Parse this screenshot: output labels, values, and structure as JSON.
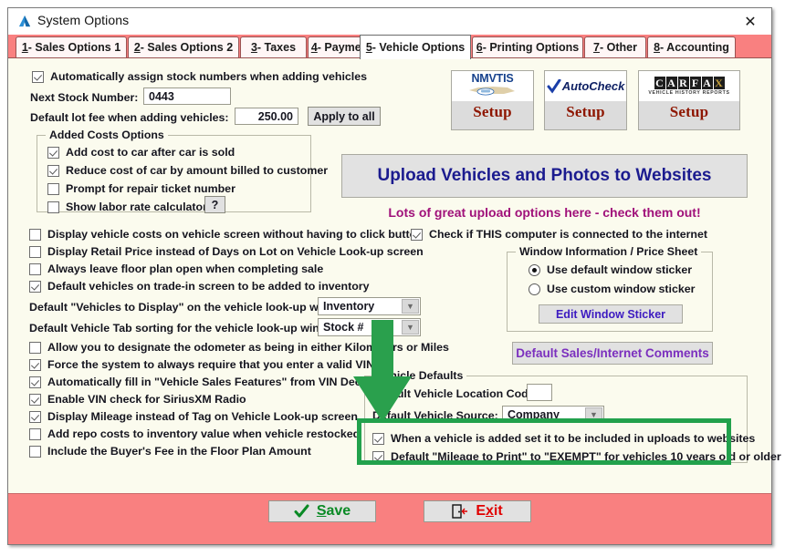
{
  "window": {
    "title": "System Options",
    "close_icon": "close-icon",
    "app_icon": "app-logo-icon"
  },
  "tabs": [
    {
      "num": "1",
      "label": " - Sales Options 1",
      "active": false
    },
    {
      "num": "2",
      "label": " - Sales Options 2",
      "active": false
    },
    {
      "num": "3",
      "label": " - Taxes",
      "active": false
    },
    {
      "num": "4",
      "label": " - Payment Options",
      "active": false
    },
    {
      "num": "5",
      "label": " - Vehicle Options",
      "active": true
    },
    {
      "num": "6",
      "label": " - Printing Options",
      "active": false
    },
    {
      "num": "7",
      "label": " - Other",
      "active": false
    },
    {
      "num": "8",
      "label": " - Accounting",
      "active": false
    }
  ],
  "left": {
    "auto_stock_label": "Automatically assign stock numbers when adding vehicles",
    "auto_stock_checked": true,
    "next_stock_label": "Next Stock Number:",
    "next_stock_value": "0443",
    "lot_fee_label": "Default lot fee when adding vehicles:",
    "lot_fee_value": "250.00",
    "apply_all_label": "Apply to all",
    "added_costs": {
      "title": "Added Costs Options",
      "items": [
        {
          "label": "Add cost to car after car is sold",
          "checked": true
        },
        {
          "label": "Reduce cost of car by amount billed to customer",
          "checked": true
        },
        {
          "label": "Prompt for repair ticket number",
          "checked": false
        },
        {
          "label": "Show labor rate calculator",
          "checked": false
        }
      ],
      "help_label": "?"
    },
    "checks_mid": [
      {
        "label": "Display vehicle costs on vehicle screen without having to click button",
        "checked": false
      },
      {
        "label": "Display Retail Price instead of Days on Lot on Vehicle Look-up screen",
        "checked": false
      },
      {
        "label": "Always leave floor plan open when completing sale",
        "checked": false
      },
      {
        "label": "Default vehicles on trade-in screen to be added to inventory",
        "checked": true
      }
    ],
    "combo_display_label": "Default \"Vehicles to Display\" on the vehicle look-up window:",
    "combo_display_value": "Inventory",
    "combo_sort_label": "Default Vehicle Tab sorting for the vehicle look-up window:",
    "combo_sort_value": "Stock #",
    "checks_low": [
      {
        "label": "Allow you to designate the odometer as being in either Kilometers or Miles",
        "checked": false
      },
      {
        "label": "Force the system to always require that you enter a valid VIN",
        "checked": true
      },
      {
        "label": "Automatically fill in \"Vehicle Sales Features\" from VIN Decoder",
        "checked": true
      },
      {
        "label": "Enable VIN check for SiriusXM Radio",
        "checked": true
      },
      {
        "label": "Display Mileage instead of Tag on Vehicle Look-up screen",
        "checked": true
      },
      {
        "label": "Add repo costs to inventory value when vehicle restocked",
        "checked": false
      },
      {
        "label": "Include the Buyer's Fee in the Floor Plan Amount",
        "checked": false
      }
    ]
  },
  "right": {
    "setup_buttons": [
      {
        "logo": "nmvtis-logo-icon",
        "brand": "NMVTIS",
        "label": "Setup"
      },
      {
        "logo": "autocheck-logo-icon",
        "brand": "AutoCheck",
        "label": "Setup"
      },
      {
        "logo": "carfax-logo-icon",
        "brand": "CARFAX",
        "sub": "VEHICLE HISTORY REPORTS",
        "label": "Setup"
      }
    ],
    "upload_banner_label": "Upload Vehicles and Photos to Websites",
    "upload_sub_label": "Lots of great upload options here - check them out!",
    "internet_check_label": "Check if THIS computer is connected to the internet",
    "internet_check_checked": true,
    "window_info": {
      "title": "Window Information / Price Sheet",
      "options": [
        {
          "label": "Use default window sticker",
          "selected": true
        },
        {
          "label": "Use custom window sticker",
          "selected": false
        }
      ],
      "edit_button": "Edit Window Sticker"
    },
    "default_comments_button": "Default Sales/Internet Comments",
    "vehicle_defaults": {
      "title": "Vehicle Defaults",
      "location_label": "Default Vehicle Location Code:",
      "location_value": "",
      "source_label": "Default Vehicle Source:",
      "source_value": "Company",
      "upload_check_label": "When a vehicle is added set it to be included in uploads to websites",
      "upload_check_checked": true,
      "exempt_check_label": "Default \"Mileage to Print\" to \"EXEMPT\" for vehicles 10 years old or older",
      "exempt_check_checked": true
    }
  },
  "footer": {
    "save_label": "Save",
    "save_accel": "S",
    "save_icon": "checkmark-icon",
    "exit_label": "Exit",
    "exit_accel": "x",
    "exit_icon": "door-exit-icon"
  },
  "annotations": {
    "arrow_color": "#2aa04d",
    "highlight_color": "#22a14c"
  }
}
